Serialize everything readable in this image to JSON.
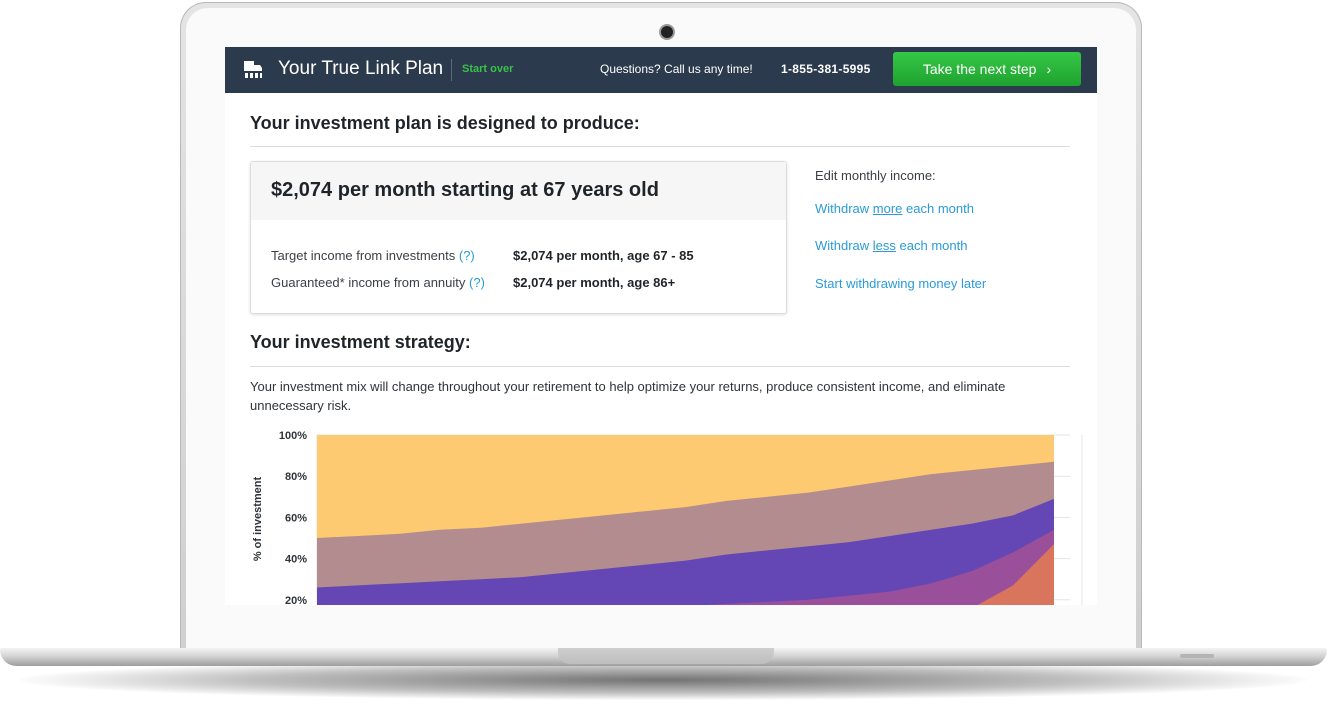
{
  "header": {
    "brand": "Your True Link Plan",
    "start_over": "Start over",
    "questions": "Questions? Call us any time!",
    "phone": "1-855-381-5995",
    "cta_label": "Take the next step",
    "cta_chevron": "›",
    "logo_icon": "true-link-logo-icon"
  },
  "plan": {
    "heading": "Your investment plan is designed to produce:",
    "summary": "$2,074 per month starting at 67 years old",
    "rows": [
      {
        "label": "Target income from investments",
        "help": "(?)",
        "value": "$2,074 per month, age 67 - 85"
      },
      {
        "label": "Guaranteed* income from annuity",
        "help": "(?)",
        "value": "$2,074 per month, age 86+"
      }
    ]
  },
  "edit": {
    "title": "Edit monthly income:",
    "more_prefix": "Withdraw ",
    "more_word": "more",
    "more_suffix": " each month",
    "less_prefix": "Withdraw ",
    "less_word": "less",
    "less_suffix": " each month",
    "later": "Start withdrawing money later"
  },
  "strategy": {
    "heading": "Your investment strategy:",
    "description": "Your investment mix will change throughout your retirement to help optimize your returns, produce consistent income, and eliminate unnecessary risk."
  },
  "colors": {
    "topbar": "#2b3a4c",
    "accent_green": "#3cc04a",
    "link_blue": "#2a9bd6",
    "series": [
      "#fdca72",
      "#b38c8f",
      "#6447b4",
      "#9a4f9a",
      "#d9745d"
    ]
  },
  "chart_data": {
    "type": "area",
    "stacked": true,
    "ylabel": "% of investment",
    "ylim": [
      0,
      100
    ],
    "yticks": [
      "100%",
      "80%",
      "60%",
      "40%",
      "20%"
    ],
    "ytick_values": [
      100,
      80,
      60,
      40,
      20
    ],
    "x": [
      0,
      1,
      2,
      3,
      4,
      5,
      6,
      7,
      8,
      9,
      10,
      11,
      12,
      13,
      14,
      15,
      16,
      17,
      18
    ],
    "grid": true,
    "series_boundaries_top_down": [
      {
        "values": [
          100,
          100,
          100,
          100,
          100,
          100,
          100,
          100,
          100,
          100,
          100,
          100,
          100,
          100,
          100,
          100,
          100,
          100,
          100
        ]
      },
      {
        "values": [
          50,
          51,
          52,
          54,
          55,
          57,
          59,
          61,
          63,
          65,
          68,
          70,
          72,
          75,
          78,
          81,
          83,
          85,
          87
        ]
      },
      {
        "values": [
          26,
          27,
          28,
          29,
          30,
          31,
          33,
          35,
          37,
          39,
          42,
          44,
          46,
          48,
          51,
          54,
          57,
          61,
          69
        ]
      },
      {
        "values": [
          0,
          0,
          0,
          0,
          0,
          0,
          0,
          0,
          16,
          17,
          18,
          19,
          20,
          22,
          24,
          28,
          34,
          43,
          54
        ]
      },
      {
        "values": [
          0,
          0,
          0,
          0,
          0,
          0,
          0,
          0,
          0,
          0,
          0,
          0,
          0,
          0,
          5,
          9,
          16,
          27,
          47
        ]
      }
    ]
  }
}
